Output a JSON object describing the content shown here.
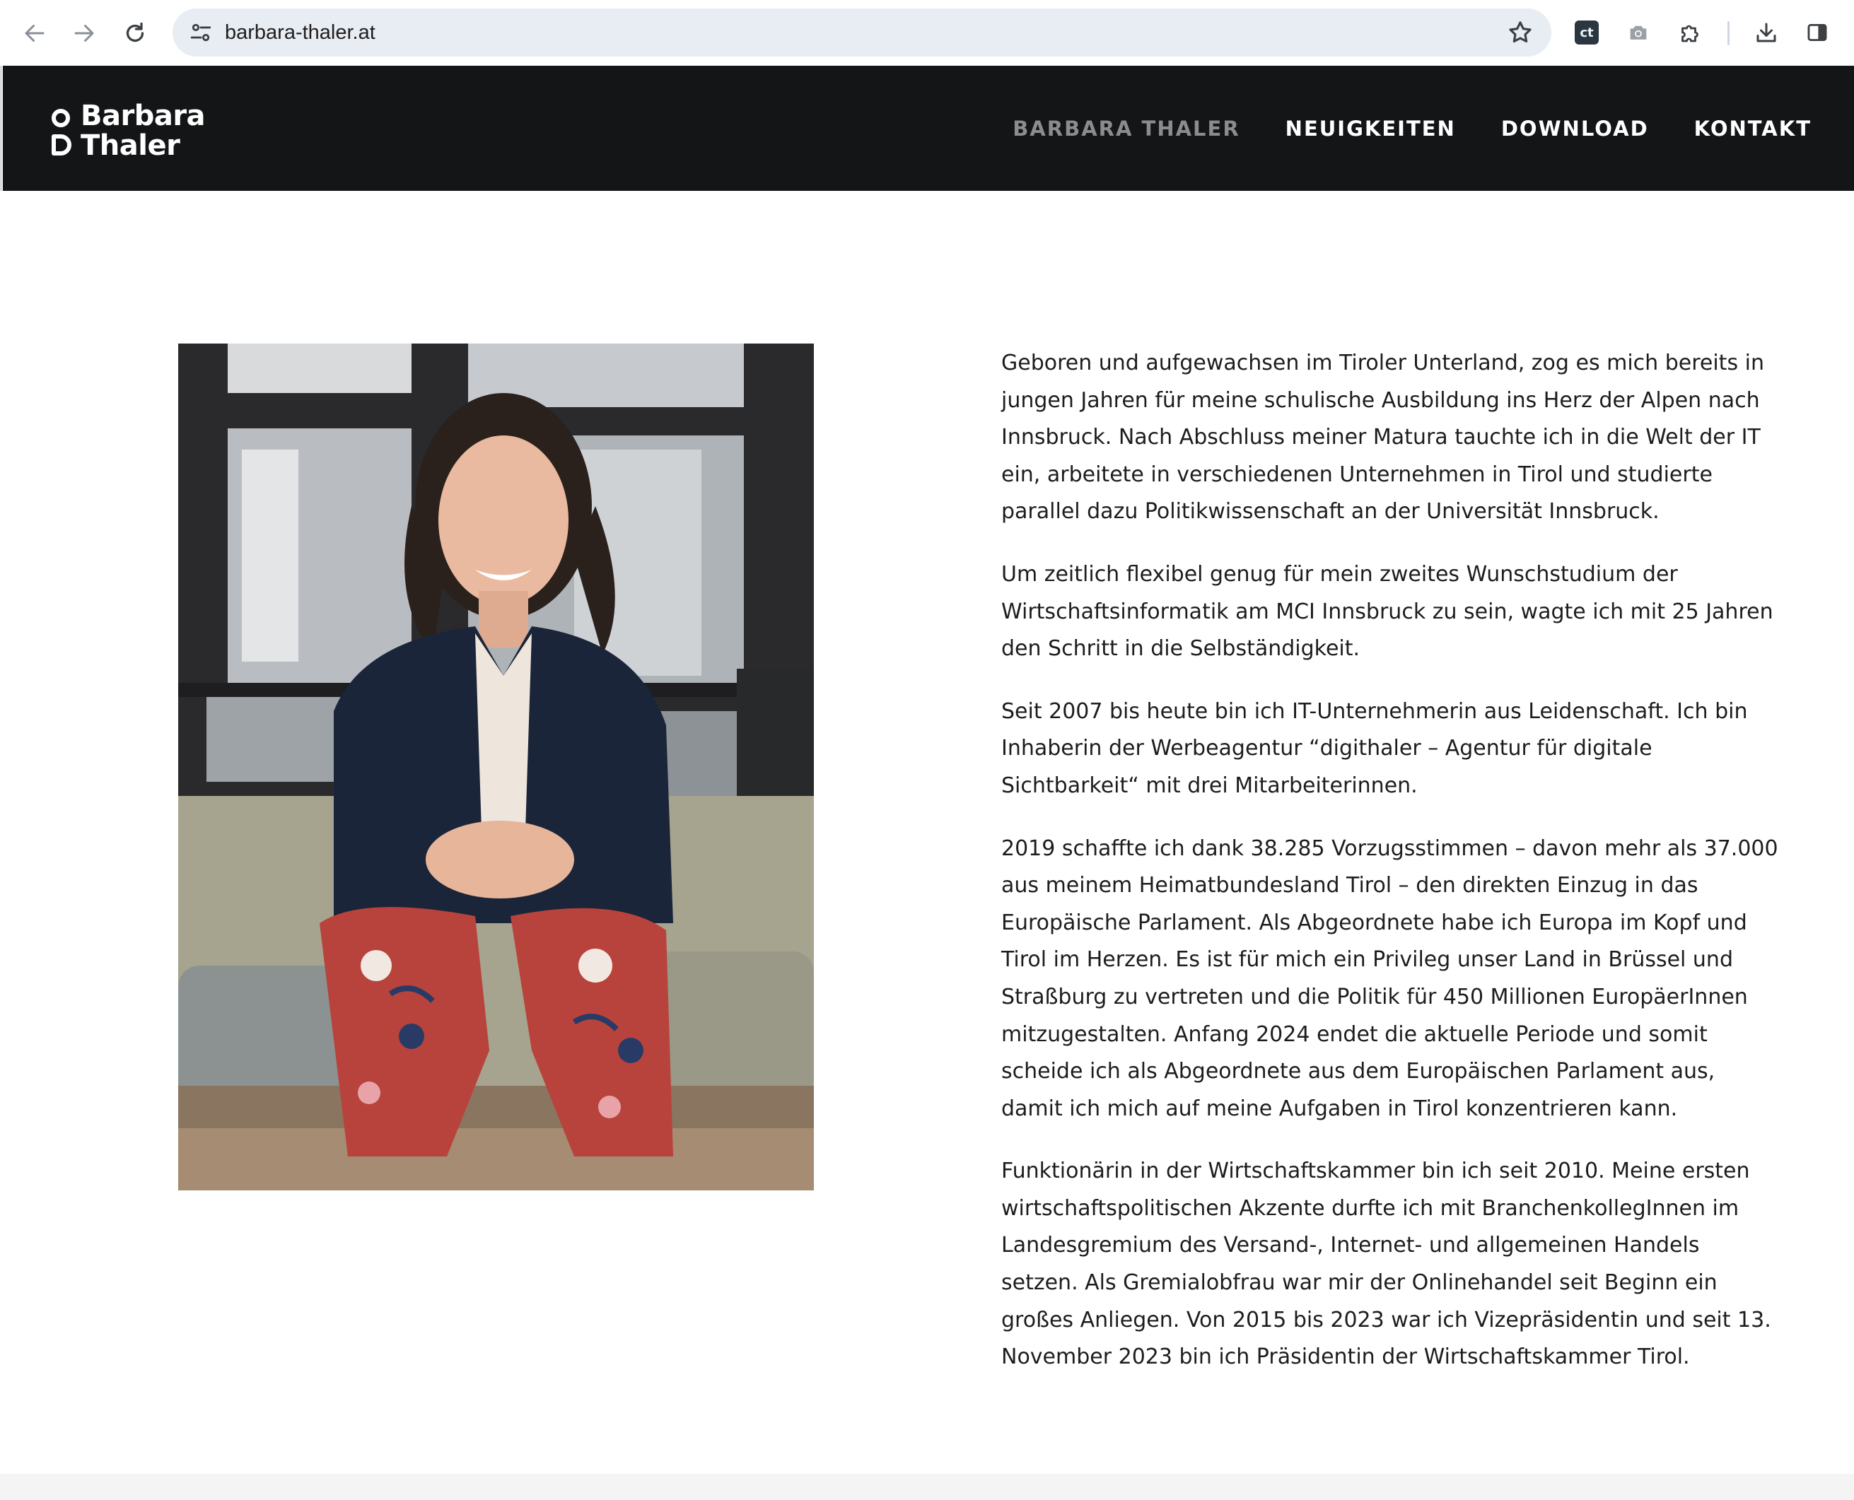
{
  "browser": {
    "url": "barbara-thaler.at",
    "extension_label": "ct"
  },
  "site": {
    "logo": {
      "line1": "Barbara",
      "line2": "Thaler"
    },
    "nav": [
      {
        "label": "BARBARA THALER",
        "active": true
      },
      {
        "label": "NEUIGKEITEN",
        "active": false
      },
      {
        "label": "DOWNLOAD",
        "active": false
      },
      {
        "label": "KONTAKT",
        "active": false
      }
    ]
  },
  "bio": {
    "paragraphs": [
      "Geboren und aufgewachsen im Tiroler Unterland, zog es mich bereits in jungen Jahren für meine schulische Ausbildung ins Herz der Alpen nach Innsbruck. Nach Abschluss meiner Matura tauchte ich in die Welt der IT ein, arbeitete in verschiedenen Unternehmen in Tirol und studierte parallel dazu Politikwissenschaft an der Universität Innsbruck.",
      "Um zeitlich flexibel genug für mein zweites Wunschstudium der Wirtschaftsinformatik am MCI Innsbruck zu sein, wagte ich mit 25 Jahren den Schritt in die Selbständigkeit.",
      "Seit 2007 bis heute bin ich IT-Unternehmerin aus Leidenschaft. Ich bin Inhaberin der Werbeagentur “digithaler – Agentur für digitale Sichtbarkeit“ mit drei Mitarbeiterinnen.",
      "2019 schaffte ich dank 38.285 Vorzugsstimmen – davon mehr als 37.000 aus meinem Heimatbundesland Tirol – den direkten Einzug in das Europäische Parlament. Als Abgeordnete habe ich Europa im Kopf und Tirol im Herzen. Es ist für mich ein Privileg unser Land in Brüssel und Straßburg zu vertreten und die Politik für 450 Millionen EuropäerInnen mitzugestalten. Anfang 2024 endet die aktuelle Periode und somit scheide ich als Abgeordnete aus dem Europäischen Parlament aus, damit ich mich auf meine Aufgaben in Tirol konzentrieren kann.",
      "Funktionärin in der Wirtschaftskammer bin ich seit 2010. Meine ersten wirtschaftspolitischen Akzente durfte ich mit BranchenkollegInnen im Landesgremium des Versand-, Internet- und allgemeinen Handels setzen. Als Gremialobfrau war mir der Onlinehandel seit Beginn ein großes Anliegen. Von 2015 bis 2023 war ich Vizepräsidentin und seit 13. November 2023 bin ich Präsidentin der Wirtschaftskammer Tirol."
    ]
  },
  "colors": {
    "header_bg": "#141517",
    "nav_active": "#8a8c90",
    "nav_default": "#ffffff",
    "omnibox_bg": "#e8ecf3"
  }
}
